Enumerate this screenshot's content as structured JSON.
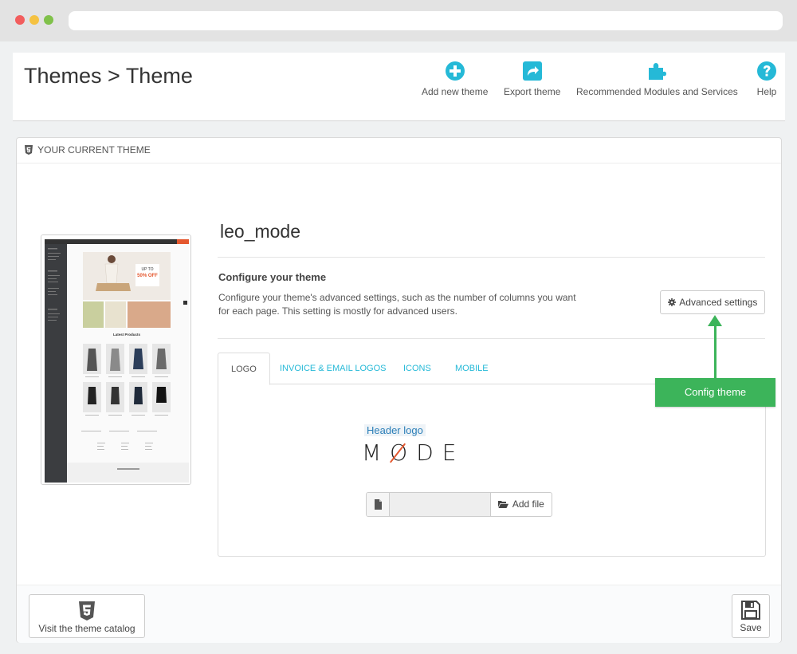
{
  "header": {
    "title": "Themes > Theme",
    "toolbar": [
      {
        "label": "Add new theme",
        "icon": "plus-circle-icon"
      },
      {
        "label": "Export theme",
        "icon": "export-icon"
      },
      {
        "label": "Recommended Modules and Services",
        "icon": "puzzle-icon"
      },
      {
        "label": "Help",
        "icon": "help-icon"
      }
    ]
  },
  "panel": {
    "heading": "YOUR CURRENT THEME",
    "theme_name": "leo_mode",
    "configure_title": "Configure your theme",
    "configure_desc": "Configure your theme's advanced settings, such as the number of columns you want for each page. This setting is mostly for advanced users.",
    "advanced_button": "Advanced settings",
    "tabs": [
      "LOGO",
      "INVOICE & EMAIL LOGOS",
      "ICONS",
      "MOBILE"
    ],
    "active_tab": "LOGO",
    "header_logo_label": "Header logo",
    "logo_text": "MODE",
    "add_file_button": "Add file"
  },
  "annotation": {
    "label": "Config theme"
  },
  "footer": {
    "visit_catalog": "Visit the theme catalog",
    "save": "Save"
  },
  "preview": {
    "promo_line1": "UP TO",
    "promo_line2": "50% OFF",
    "section_title": "Latest Products"
  },
  "colors": {
    "accent": "#25b9d7",
    "callout": "#3cb45a",
    "brand_orange": "#e4572e"
  }
}
